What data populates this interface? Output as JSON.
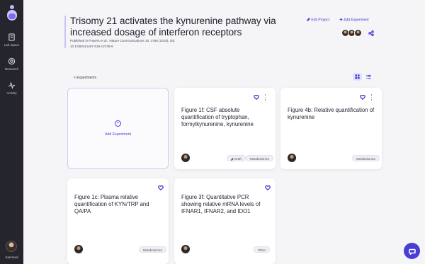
{
  "sidebar": {
    "items": [
      {
        "label": "Lab Space",
        "icon": "document-icon"
      },
      {
        "label": "Research",
        "icon": "target-icon"
      },
      {
        "label": "Activity",
        "icon": "activity-icon"
      }
    ],
    "username": "Sammed"
  },
  "header": {
    "title": "Trisomy 21 activates the kynurenine pathway via increased dosage of interferon receptors",
    "published": "Published in Powers et al., Nature Communications 10, 4766 (2019), doi:",
    "doi": "10.1038/s41467-019-12739-9",
    "edit_label": "Edit Project",
    "add_label": "Add Experiment"
  },
  "toolbar": {
    "back_label": "< Experiments"
  },
  "add_card": {
    "label": "Add Experiment",
    "icon": "plus-circle-icon"
  },
  "cards": [
    {
      "title": "Figure 1f: CSF absolute quantification of tryptophan, formylkynurenine, kynurenine",
      "tags": [
        "Draft",
        "Metabolomics"
      ]
    },
    {
      "title": "Figure 4b: Relative quantification of kynurenine",
      "tags": [
        "Metabolomics"
      ]
    },
    {
      "title": "Figure 1c: Plasma relative quantification of KYN/TRP and QA/PA",
      "tags": [
        "Metabolomics"
      ]
    },
    {
      "title": "Figure 3f: Quantitative PCR showing relative mRNA levels of IFNAR1, IFNAR2, and IDO1",
      "tags": [
        "Other"
      ]
    }
  ],
  "colors": {
    "accent": "#4a3fd4",
    "sidebar": "#24252d",
    "background": "#f5f5f7"
  }
}
